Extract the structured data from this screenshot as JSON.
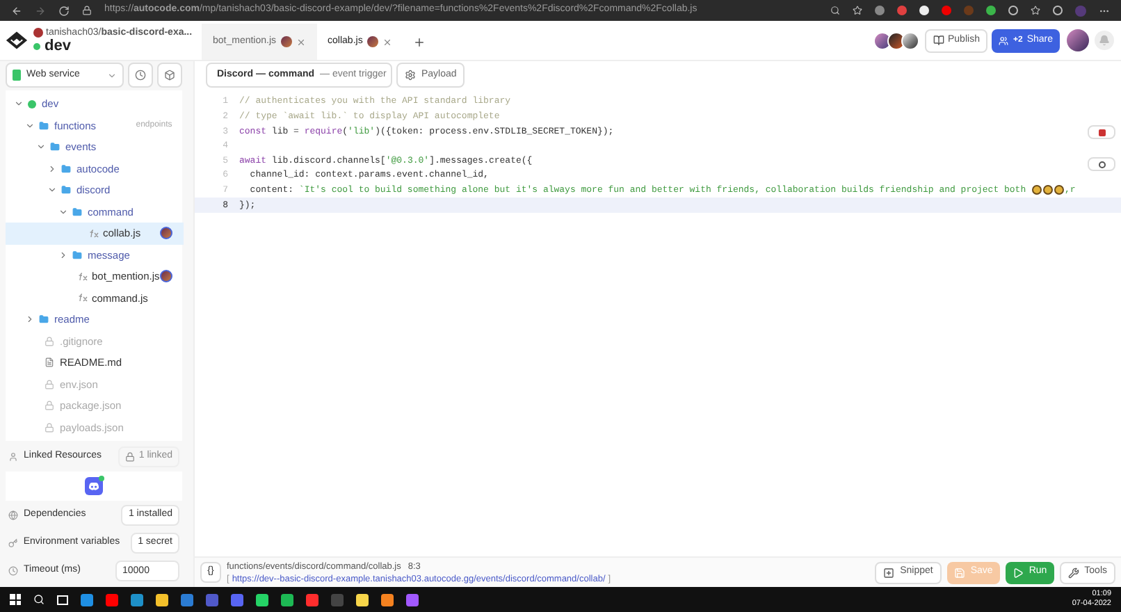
{
  "browser": {
    "url": "https://**autocode.com**/mp/tanishach03/basic-discord-example/dev/?filename=functions%2Fevents%2Fdiscord%2Fcommand%2Fcollab.js"
  },
  "header": {
    "project": "tanishach03/**basic-discord-exa...**",
    "environment": "dev",
    "publish": "Publish",
    "share_count": "+2",
    "share": "Share"
  },
  "tabs": [
    {
      "label": "bot_mention.js",
      "selected": false
    },
    {
      "label": "collab.js",
      "selected": true
    }
  ],
  "sidebar": {
    "service": "Web service",
    "tree": [
      {
        "label": "dev",
        "kind": "env",
        "expanded": true,
        "selected": false,
        "collaborator": false,
        "children": [
          {
            "label": "functions",
            "kind": "folder",
            "expanded": true,
            "selected": false,
            "collaborator": false,
            "tag": "endpoints",
            "children": [
              {
                "label": "events",
                "kind": "folder",
                "expanded": true,
                "selected": false,
                "collaborator": false,
                "children": [
                  {
                    "label": "autocode",
                    "kind": "folder",
                    "expanded": false,
                    "selected": false,
                    "collaborator": false
                  },
                  {
                    "label": "discord",
                    "kind": "folder",
                    "expanded": true,
                    "selected": false,
                    "collaborator": false,
                    "children": [
                      {
                        "label": "command",
                        "kind": "folder",
                        "expanded": true,
                        "selected": false,
                        "collaborator": false,
                        "children": [
                          {
                            "label": "collab.js",
                            "kind": "fn",
                            "selected": true,
                            "collaborator": true
                          }
                        ]
                      },
                      {
                        "label": "message",
                        "kind": "folder",
                        "expanded": false,
                        "selected": false,
                        "collaborator": false
                      },
                      {
                        "label": "bot_mention.js",
                        "kind": "fn",
                        "selected": false,
                        "collaborator": true
                      },
                      {
                        "label": "command.js",
                        "kind": "fn",
                        "selected": false,
                        "collaborator": false
                      }
                    ]
                  }
                ]
              }
            ]
          },
          {
            "label": "readme",
            "kind": "folder",
            "expanded": false,
            "selected": false,
            "collaborator": false
          },
          {
            "label": ".gitignore",
            "kind": "locked",
            "selected": false,
            "collaborator": false
          },
          {
            "label": "README.md",
            "kind": "doc",
            "selected": false,
            "collaborator": false
          },
          {
            "label": "env.json",
            "kind": "locked",
            "selected": false,
            "collaborator": false
          },
          {
            "label": "package.json",
            "kind": "locked",
            "selected": false,
            "collaborator": false
          },
          {
            "label": "payloads.json",
            "kind": "locked",
            "selected": false,
            "collaborator": false
          }
        ]
      }
    ],
    "linked_resources": {
      "label": "Linked Resources",
      "count": "1 linked"
    },
    "settings": [
      {
        "label": "Dependencies",
        "kind": "badge",
        "value": "1 installed"
      },
      {
        "label": "Environment variables",
        "kind": "badge",
        "value": "1 secret"
      },
      {
        "label": "Timeout (ms)",
        "kind": "input",
        "value": "10000"
      }
    ]
  },
  "editor": {
    "trigger": "Discord — command",
    "trigger_type": "— event trigger",
    "payload": "Payload",
    "lines": [
      {
        "number": "1",
        "selected": false,
        "tokens": [
          {
            "kind": "comment",
            "text": "// authenticates you with the API standard library"
          }
        ]
      },
      {
        "number": "2",
        "selected": false,
        "tokens": [
          {
            "kind": "comment",
            "text": "// type `await lib.` to display API autocomplete"
          }
        ]
      },
      {
        "number": "3",
        "selected": false,
        "tokens": [
          {
            "kind": "keyword",
            "text": "const"
          },
          {
            "kind": "plain",
            "text": " lib = "
          },
          {
            "kind": "keyword",
            "text": "require"
          },
          {
            "kind": "plain",
            "text": "("
          },
          {
            "kind": "string",
            "text": "'lib'"
          },
          {
            "kind": "plain",
            "text": ")({token: process.env.STDLIB_SECRET_TOKEN});"
          }
        ]
      },
      {
        "number": "4",
        "selected": false
      },
      {
        "number": "5",
        "selected": false,
        "tokens": [
          {
            "kind": "keyword",
            "text": "await"
          },
          {
            "kind": "plain",
            "text": " lib.discord.channels["
          },
          {
            "kind": "string",
            "text": "'@0.3.0'"
          },
          {
            "kind": "plain",
            "text": "].messages.create({"
          }
        ]
      },
      {
        "number": "6",
        "selected": false,
        "tokens": [
          {
            "kind": "plain",
            "text": "  channel_id: context.params.event.channel_id,"
          }
        ]
      },
      {
        "number": "7",
        "selected": false,
        "tokens": [
          {
            "kind": "plain",
            "text": "  content: "
          },
          {
            "kind": "string",
            "text": "`It's cool to build something alone but it's always more fun and better with friends, collaboration builds friendship and project both "
          },
          {
            "kind": "emoji"
          },
          {
            "kind": "emoji"
          },
          {
            "kind": "emoji"
          },
          {
            "kind": "string",
            "text": ",r"
          }
        ]
      },
      {
        "number": "8",
        "selected": true,
        "tokens": [
          {
            "kind": "plain",
            "text": "});"
          }
        ]
      }
    ]
  },
  "status_bar": {
    "braces": "{}",
    "path": "functions/events/discord/command/collab.js",
    "position": "8:3",
    "url_open": "[",
    "url": "https://dev--basic-discord-example.tanishach03.autocode.gg/events/discord/command/collab/",
    "url_close": "]",
    "buttons": [
      {
        "label": "Snippet",
        "kind": "snippet"
      },
      {
        "label": "Save",
        "kind": "save"
      },
      {
        "label": "Run",
        "kind": "run"
      },
      {
        "label": "Tools",
        "kind": "tools"
      }
    ]
  },
  "taskbar": {
    "time": "01:09",
    "date": "07-04-2022"
  }
}
